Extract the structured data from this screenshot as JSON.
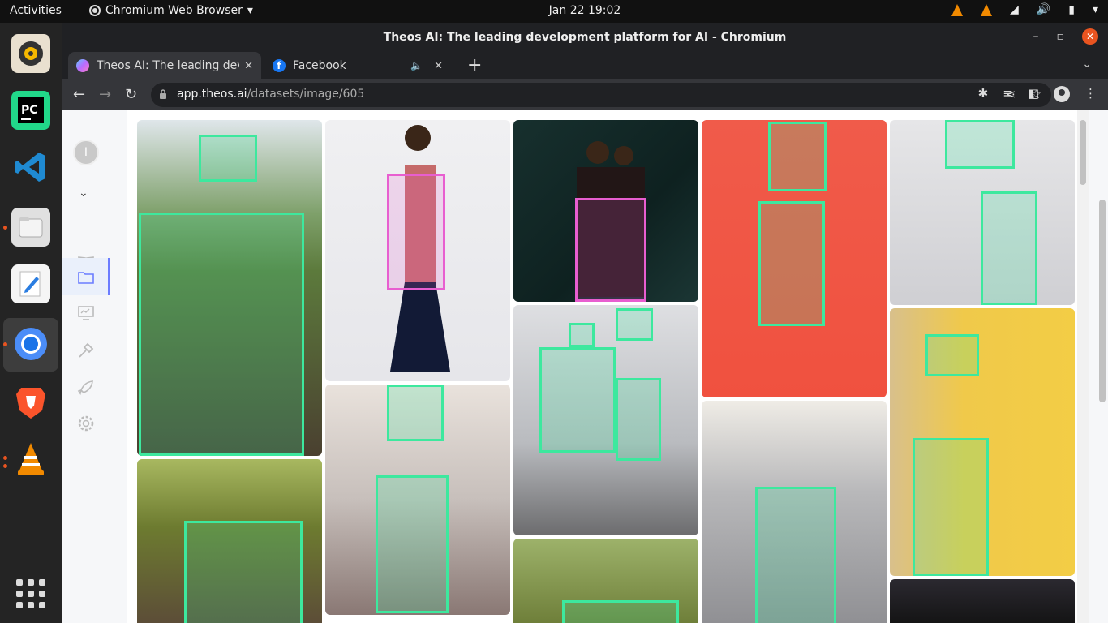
{
  "topbar": {
    "activities": "Activities",
    "app_name": "Chromium Web Browser",
    "clock": "Jan 22  19:02"
  },
  "window": {
    "title": "Theos AI: The leading development platform for AI - Chromium"
  },
  "tabs": [
    {
      "label": "Theos AI: The leading development platform for AI",
      "favicon_color": "#8a5cff"
    },
    {
      "label": "Facebook",
      "favicon_color": "#1877f2"
    }
  ],
  "address": {
    "host": "app.theos.ai",
    "path": "/datasets/image/605"
  },
  "sidenav": {
    "avatar_letter": "I"
  },
  "colors": {
    "bbox_green": "#3de89e",
    "bbox_pink": "#e85ed0",
    "accent": "#6b7cff"
  }
}
